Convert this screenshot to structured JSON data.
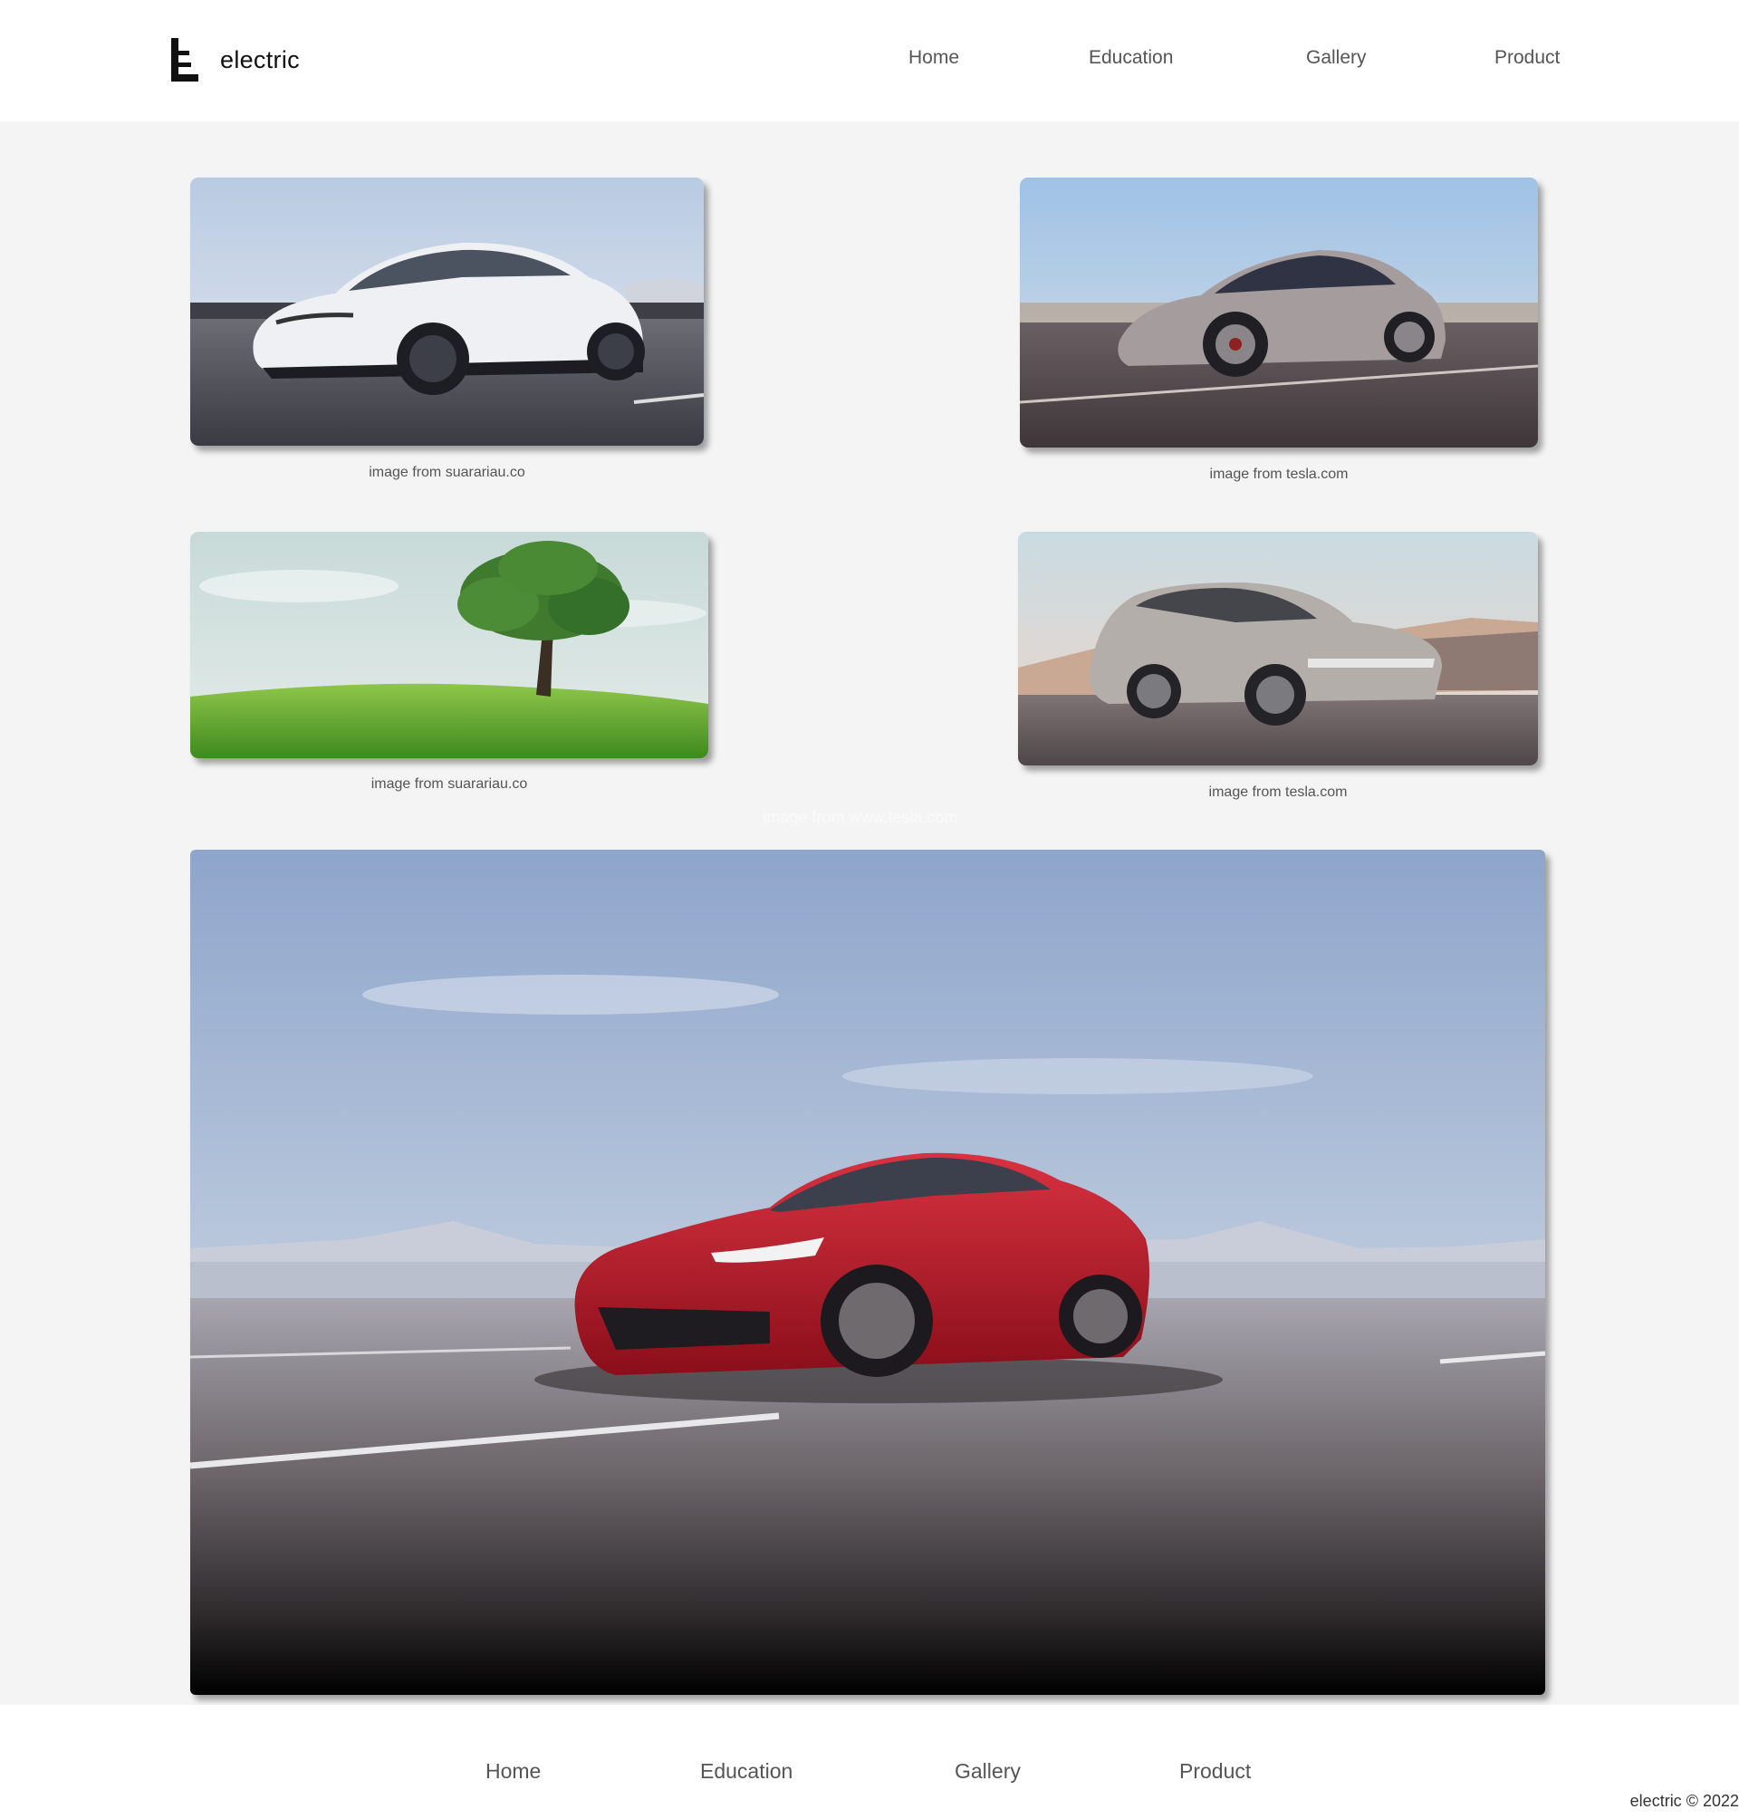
{
  "brand": {
    "name": "electric",
    "logo_icon": "letter-e-logo-icon"
  },
  "header": {
    "nav": [
      {
        "label": "Home"
      },
      {
        "label": "Education"
      },
      {
        "label": "Gallery"
      },
      {
        "label": "Product"
      }
    ]
  },
  "gallery": {
    "cards": [
      {
        "image": "white-suv-photo",
        "caption": "image from suarariau.co"
      },
      {
        "image": "gray-crossover-photo",
        "caption": "image from tesla.com"
      },
      {
        "image": "tree-on-grass-photo",
        "caption": "image from suarariau.co"
      },
      {
        "image": "silver-hatchback-photo",
        "caption": "image from tesla.com"
      }
    ],
    "hero": {
      "image": "red-sedan-photo",
      "caption": "image from www.tesla.com"
    }
  },
  "footer": {
    "nav": [
      {
        "label": "Home"
      },
      {
        "label": "Education"
      },
      {
        "label": "Gallery"
      },
      {
        "label": "Product"
      }
    ],
    "copyright": "electric © 2022"
  },
  "colors": {
    "page_background": "#f4f4f4",
    "header_background": "#ffffff",
    "text": "#555555",
    "brand_text": "#111111"
  }
}
